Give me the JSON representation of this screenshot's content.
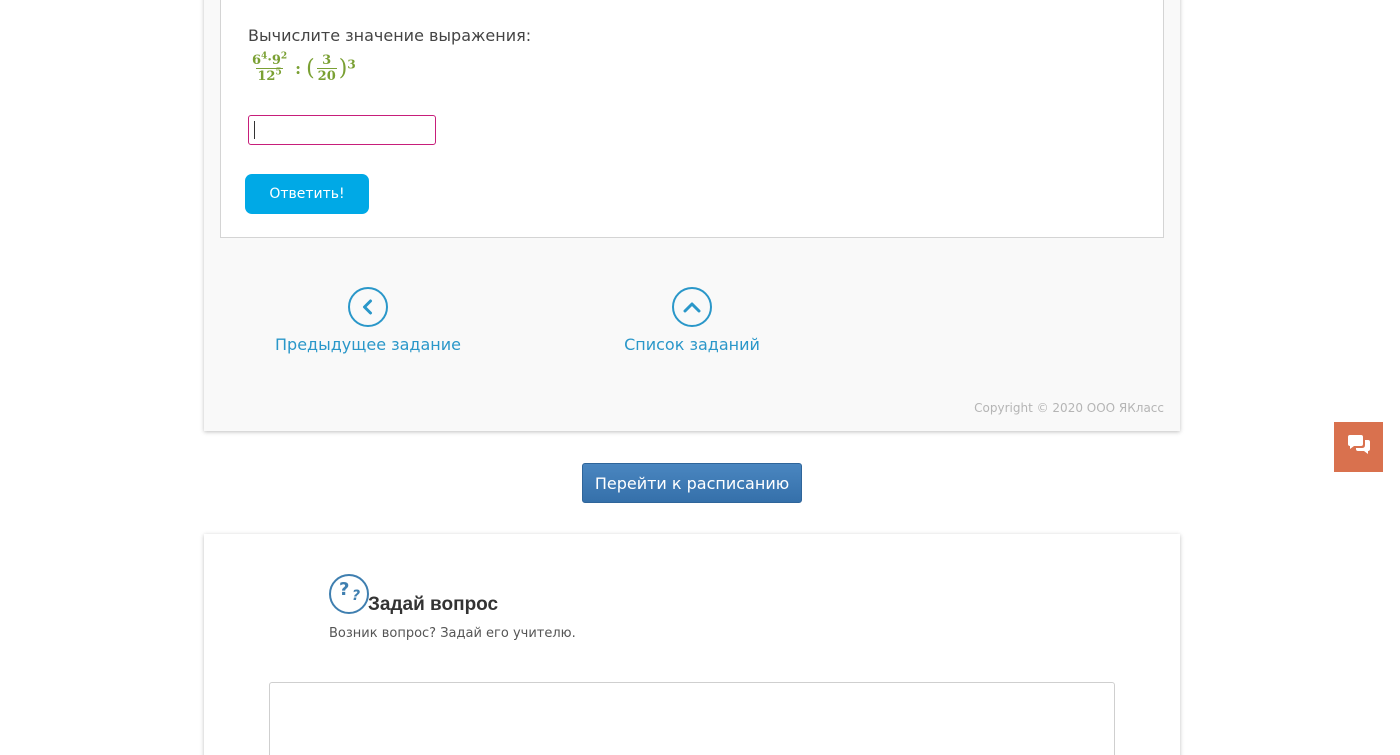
{
  "task": {
    "prompt": "Вычислите значение выражения:",
    "formula": {
      "num_a_base": "6",
      "num_a_exp": "4",
      "dot": "·",
      "num_b_base": "9",
      "num_b_exp": "2",
      "den_base": "12",
      "den_exp": "5",
      "operator": ":",
      "open_paren": "(",
      "inner_num": "3",
      "inner_den": "20",
      "close_paren": ")",
      "outer_exp": "3"
    },
    "answer_value": "",
    "submit_label": "Ответить!"
  },
  "navigation": {
    "prev_label": "Предыдущее задание",
    "list_label": "Список заданий"
  },
  "footer": {
    "copyright": "Copyright © 2020 ООО ЯКласс"
  },
  "schedule_button": {
    "label": "Перейти к расписанию"
  },
  "ask": {
    "icon_q1": "?",
    "icon_q2": "?",
    "title": "Задай вопрос",
    "subtitle": "Возник вопрос? Задай его учителю.",
    "textarea_value": ""
  },
  "colors": {
    "accent_blue": "#00a9e6",
    "link_blue": "#2a97c9",
    "formula_green": "#7aa033",
    "input_border": "#c71e7a",
    "chat_orange": "#d9714e"
  },
  "icons": {
    "prev": "chevron-left-circle-icon",
    "list": "chevron-up-circle-icon",
    "chat": "chat-bubbles-icon",
    "question": "question-icon"
  }
}
